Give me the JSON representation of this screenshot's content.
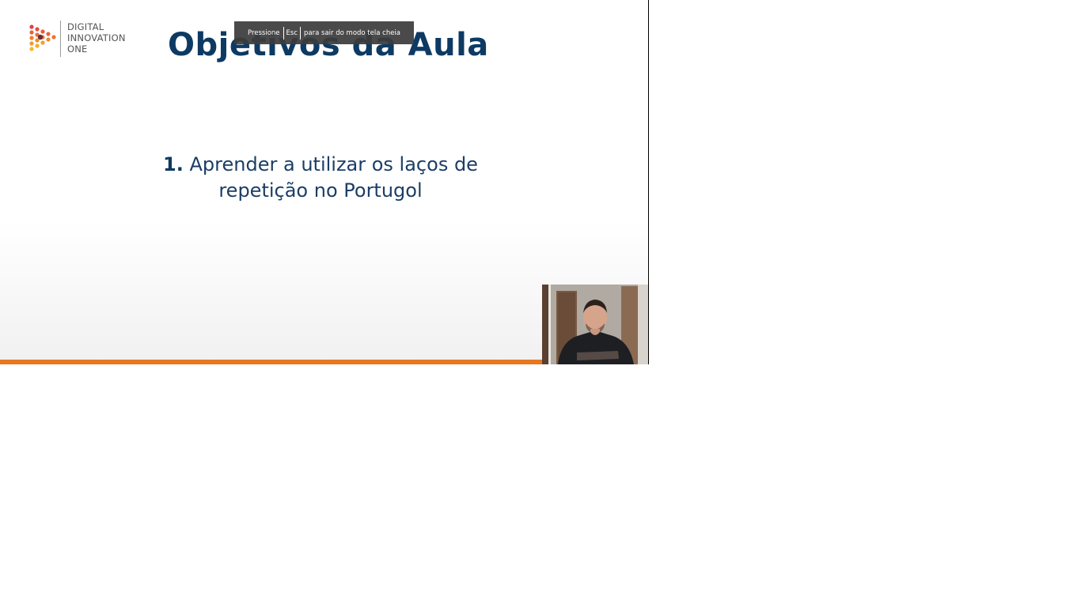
{
  "fullscreen_notice": {
    "prefix": "Pressione",
    "key": "Esc",
    "suffix": "para sair do modo tela cheia"
  },
  "slide": {
    "logo": {
      "line1": "DIGITAL",
      "line2": "INNOVATION",
      "line3": "ONE"
    },
    "title": "Objetivos da Aula",
    "objective_number": "1.",
    "objective_text": "Aprender a utilizar os laços de repetição no Portugol"
  },
  "colors": {
    "title_navy": "#0d3a63",
    "accent_orange": "#e8771f",
    "toast_bg": "#3c3c3c"
  }
}
